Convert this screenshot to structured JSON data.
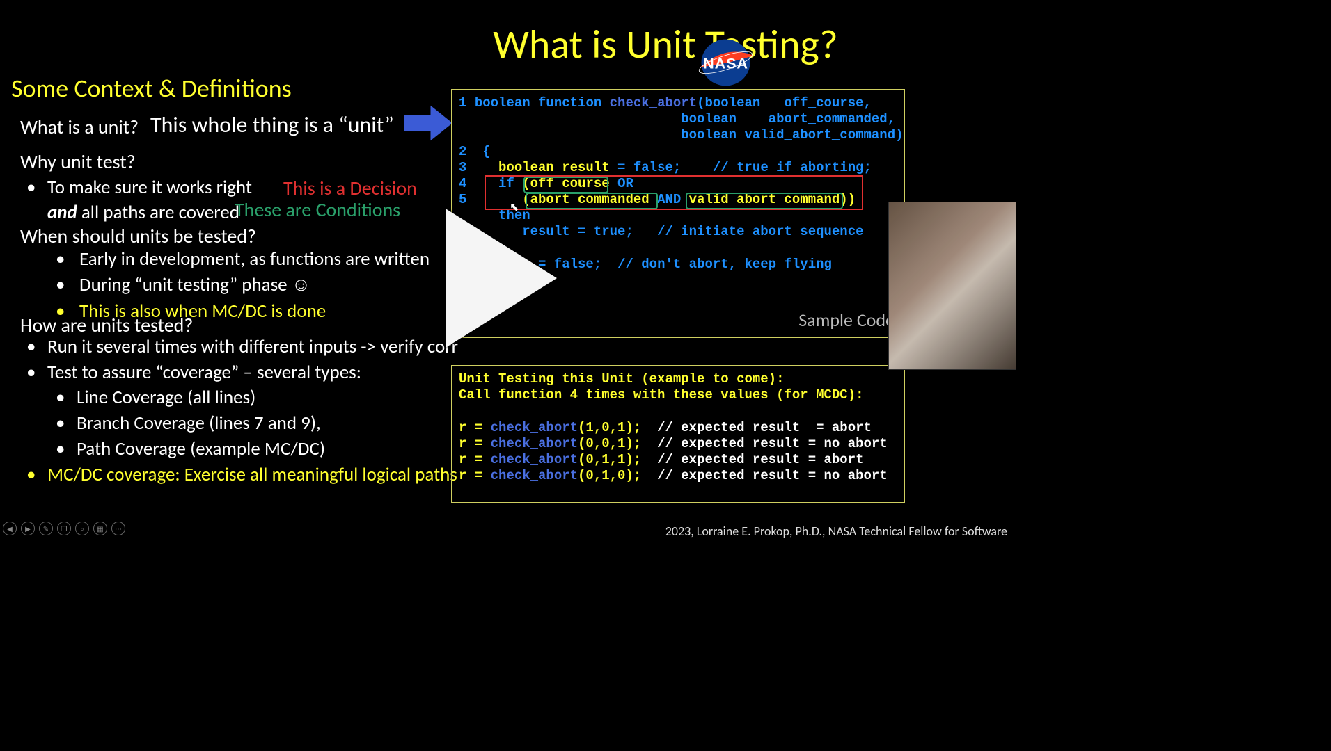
{
  "title": "What is Unit Testing?",
  "subtitle": "Some Context & Definitions",
  "q1": "What is a unit?",
  "a1": "This whole thing is a “unit”",
  "q2": "Why unit test?",
  "b1a": "To make sure it works right",
  "b1b_prefix": "and",
  "b1b_rest": " all paths are covered",
  "red": "This is a Decision",
  "green": "These are Conditions",
  "q3": "When should units be tested?",
  "b2a": "Early in development, as functions are written",
  "b2b": "During “unit testing” phase  ☺",
  "b2c": "This is also when MC/DC is done",
  "q4": "How are units tested?",
  "b3a": "Run it several times with different inputs -> verify corr",
  "b3b": "Test to assure “coverage” – several types:",
  "b3c": "Line Coverage (all lines)",
  "b3d": "Branch Coverage (lines 7 and 9),",
  "b3e": "Path Coverage (example MC/DC)",
  "b3f": "MC/DC coverage: Exercise all meaningful logical paths",
  "sample_label": "Sample Code",
  "code1": {
    "l1a": "1 ",
    "l1b": "boolean function ",
    "l1c": "check_abort",
    "l1d": "(boolean   off_course,",
    "l1e": "                            boolean    abort_commanded,",
    "l1f": "                            boolean valid_abort_command)",
    "l2": "2  {",
    "l3a": "3    ",
    "l3b": "boolean result",
    "l3c": " = ",
    "l3d": "false",
    "l3e": ";    ",
    "l3f": "// true if aborting;",
    "l4a": "4    ",
    "l4b": "if ",
    "l4c": "(off_course ",
    "l4d": "OR",
    "l5a": "5       ",
    "l5c": "(abort_commanded ",
    "l5d": "AND ",
    "l5e": "valid_abort_command))",
    "l6": "     then",
    "l7a": "        result = ",
    "l7b": "true",
    "l7c": ";   ",
    "l7d": "// initiate abort sequence",
    "l8": "",
    "l9a": "          = ",
    "l9b": "false",
    "l9c": ";  ",
    "l9d": "// don't abort, keep flying"
  },
  "code2": {
    "h1": "Unit Testing this Unit (example to come):",
    "h2": "Call function 4 times with these values (for MCDC):",
    "r_prefix": "r = ",
    "fn": "check_abort",
    "c1_args": "(1,0,1);  ",
    "c1_cmt": "// expected result  = abort",
    "c2_args": "(0,0,1);  ",
    "c2_cmt": "// expected result = no abort",
    "c3_args": "(0,1,1);  ",
    "c3_cmt": "// expected result = abort",
    "c4_args": "(0,1,0);  ",
    "c4_cmt": "// expected result = no abort"
  },
  "credit": "2023, Lorraine E. Prokop, Ph.D., NASA Technical Fellow for Software",
  "nasa_label": "NASA",
  "ctrl_icons": [
    "◀",
    "▶",
    "✎",
    "❐",
    "⌕",
    "▦",
    "⋯"
  ]
}
